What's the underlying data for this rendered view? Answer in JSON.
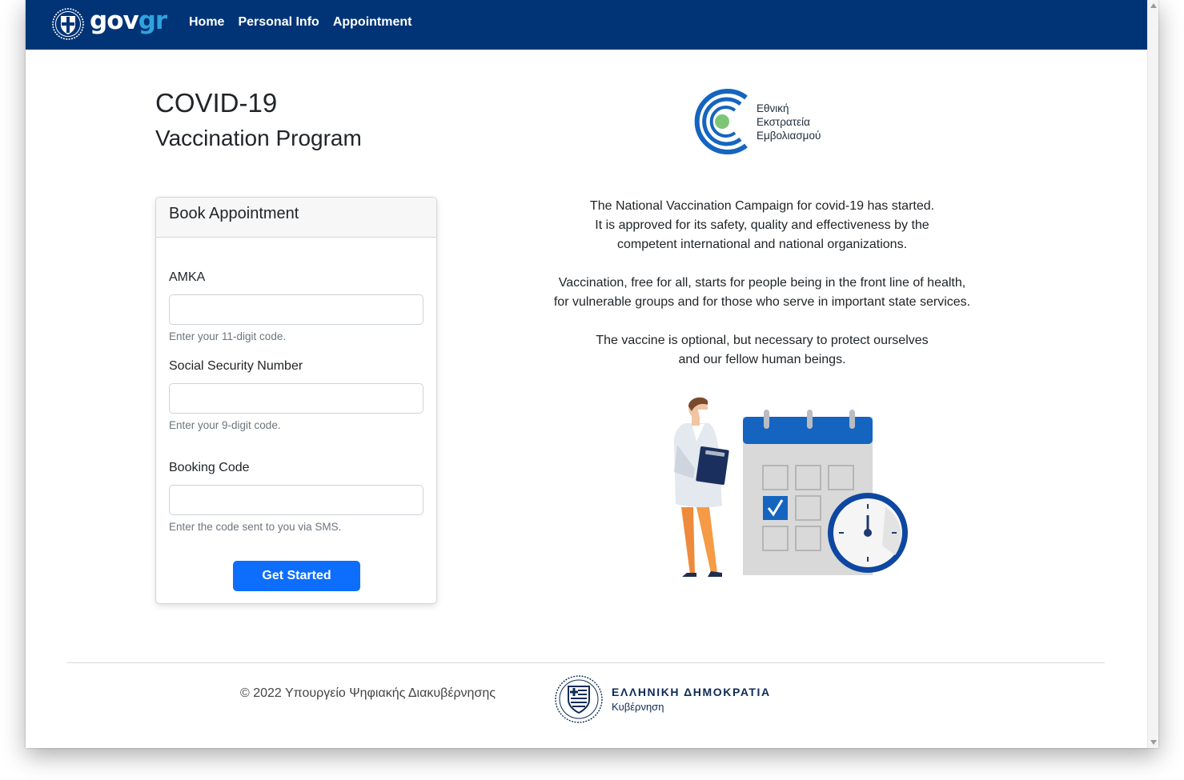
{
  "nav": {
    "brand_part1": "gov",
    "brand_part2": "gr",
    "links": [
      "Home",
      "Personal Info",
      "Appointment"
    ]
  },
  "heading": {
    "line1": "COVID-19",
    "line2": "Vaccination Program"
  },
  "form": {
    "title": "Book Appointment",
    "fields": [
      {
        "label": "AMKA",
        "value": "",
        "help": "Enter your 11-digit code."
      },
      {
        "label": "Social Security Number",
        "value": "",
        "help": "Enter your 9-digit code."
      },
      {
        "label": "Booking Code",
        "value": "",
        "help": "Enter the code sent to you via SMS."
      }
    ],
    "submit_label": "Get Started"
  },
  "campaign": {
    "logo_lines": [
      "Εθνική",
      "Εκστρατεία",
      "Εμβολιασμού"
    ]
  },
  "info": {
    "paragraphs": [
      [
        "The National Vaccination Campaign for covid-19 has started.",
        "It is approved for its safety, quality and effectiveness by the",
        "competent international and national organizations."
      ],
      [
        "Vaccination, free for all, starts for people being in the front line of health,",
        "for vulnerable groups and for those who serve in important state services."
      ],
      [
        "The vaccine is optional, but necessary to protect ourselves",
        "and our fellow human beings."
      ]
    ]
  },
  "footer": {
    "copyright": "© 2022 Υπουργείο Ψηφιακής Διακυβέρνησης",
    "org_line1": "ΕΛΛΗΝΙΚΗ ΔΗΜΟΚΡΑΤΙΑ",
    "org_line2": "Κυβέρνηση"
  },
  "colors": {
    "navbar": "#003476",
    "brand_accent": "#31a2dd",
    "primary_button": "#0d6efd",
    "campaign_blue": "#1565c0",
    "campaign_green": "#7cc576"
  },
  "icons": [
    "greek-emblem-icon",
    "campaign-logo-icon",
    "doctor-calendar-illustration",
    "hellenic-republic-emblem-icon"
  ]
}
